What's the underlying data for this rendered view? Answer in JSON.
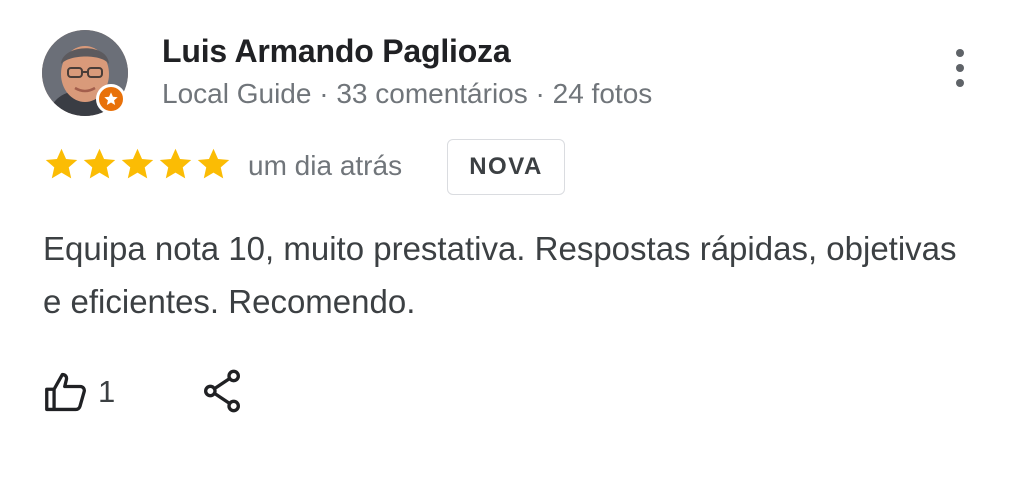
{
  "review": {
    "reviewer": {
      "name": "Luis Armando Paglioza",
      "meta": "Local Guide · 33 comentários · 24 fotos",
      "avatar": "profile-photo",
      "badge_icon": "local-guide-star-icon",
      "badge_color": "#e8710a"
    },
    "rating": {
      "stars": 5,
      "max": 5,
      "star_color": "#fbbc04"
    },
    "date": "um dia atrás",
    "new_badge": "NOVA",
    "text": "Equipa nota 10, muito prestativa. Respostas rápidas, objetivas e eficientes. Recomendo.",
    "actions": {
      "like_icon": "thumbs-up-icon",
      "like_count": "1",
      "share_icon": "share-icon",
      "more_icon": "more-vert-icon"
    }
  }
}
